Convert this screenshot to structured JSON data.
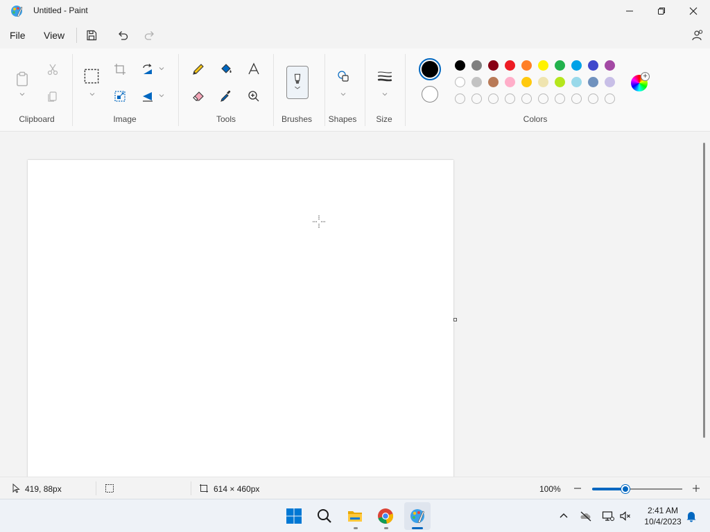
{
  "window": {
    "title": "Untitled - Paint"
  },
  "menu": {
    "file": "File",
    "view": "View"
  },
  "ribbon": {
    "groups": {
      "clipboard": "Clipboard",
      "image": "Image",
      "tools": "Tools",
      "brushes": "Brushes",
      "shapes": "Shapes",
      "size": "Size",
      "colors": "Colors"
    },
    "primary_color": "#000000",
    "secondary_color": "#ffffff",
    "palette_row1": [
      "#000000",
      "#7f7f7f",
      "#880015",
      "#ed1c24",
      "#ff7f27",
      "#fff200",
      "#22b14c",
      "#00a2e8",
      "#3f48cc",
      "#a349a4"
    ],
    "palette_row2": [
      "#ffffff",
      "#c3c3c3",
      "#b97a57",
      "#ffaec9",
      "#ffc90e",
      "#efe4b0",
      "#b5e61d",
      "#99d9ea",
      "#7092be",
      "#c8bfe7"
    ],
    "palette_row3": [
      "",
      "",
      "",
      "",
      "",
      "",
      "",
      "",
      "",
      ""
    ]
  },
  "status": {
    "cursor_position": "419, 88px",
    "canvas_size": "614 × 460px",
    "zoom": "100%",
    "zoom_fraction": 0.37
  },
  "taskbar": {
    "time": "2:41 AM",
    "date": "10/4/2023"
  },
  "accent_color": "#0067c0"
}
